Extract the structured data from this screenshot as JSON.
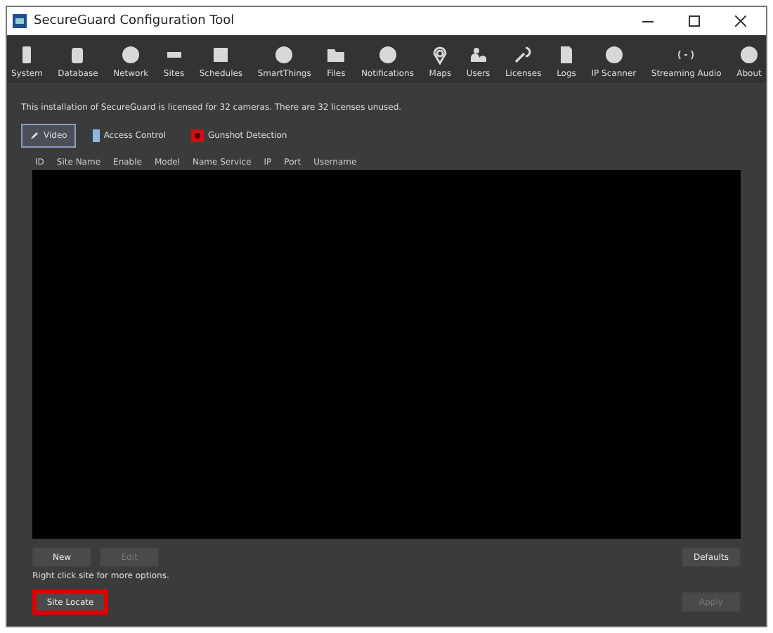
{
  "window": {
    "title": "SecureGuard Configuration Tool"
  },
  "toolbar": [
    {
      "label": "System"
    },
    {
      "label": "Database"
    },
    {
      "label": "Network"
    },
    {
      "label": "Sites"
    },
    {
      "label": "Schedules"
    },
    {
      "label": "SmartThings"
    },
    {
      "label": "Files"
    },
    {
      "label": "Notifications"
    },
    {
      "label": "Maps"
    },
    {
      "label": "Users"
    },
    {
      "label": "Licenses"
    },
    {
      "label": "Logs"
    },
    {
      "label": "IP Scanner"
    },
    {
      "label": "Streaming Audio"
    },
    {
      "label": "About"
    }
  ],
  "license_message": "This installation of SecureGuard is licensed for 32 cameras. There are 32 licenses unused.",
  "tabs": [
    {
      "label": "Video",
      "selected": true
    },
    {
      "label": "Access Control",
      "selected": false
    },
    {
      "label": "Gunshot Detection",
      "selected": false
    }
  ],
  "table": {
    "columns": [
      "ID",
      "Site Name",
      "Enable",
      "Model",
      "Name Service",
      "IP",
      "Port",
      "Username"
    ]
  },
  "buttons_left": [
    {
      "label": "New",
      "disabled": false
    },
    {
      "label": "Edit",
      "disabled": true
    }
  ],
  "button_defaults": {
    "label": "Defaults",
    "disabled": false
  },
  "hint": "Right click site for more options.",
  "site_locate": {
    "label": "Site Locate",
    "disabled": false,
    "highlighted": true
  },
  "apply": {
    "label": "Apply",
    "disabled": true
  }
}
